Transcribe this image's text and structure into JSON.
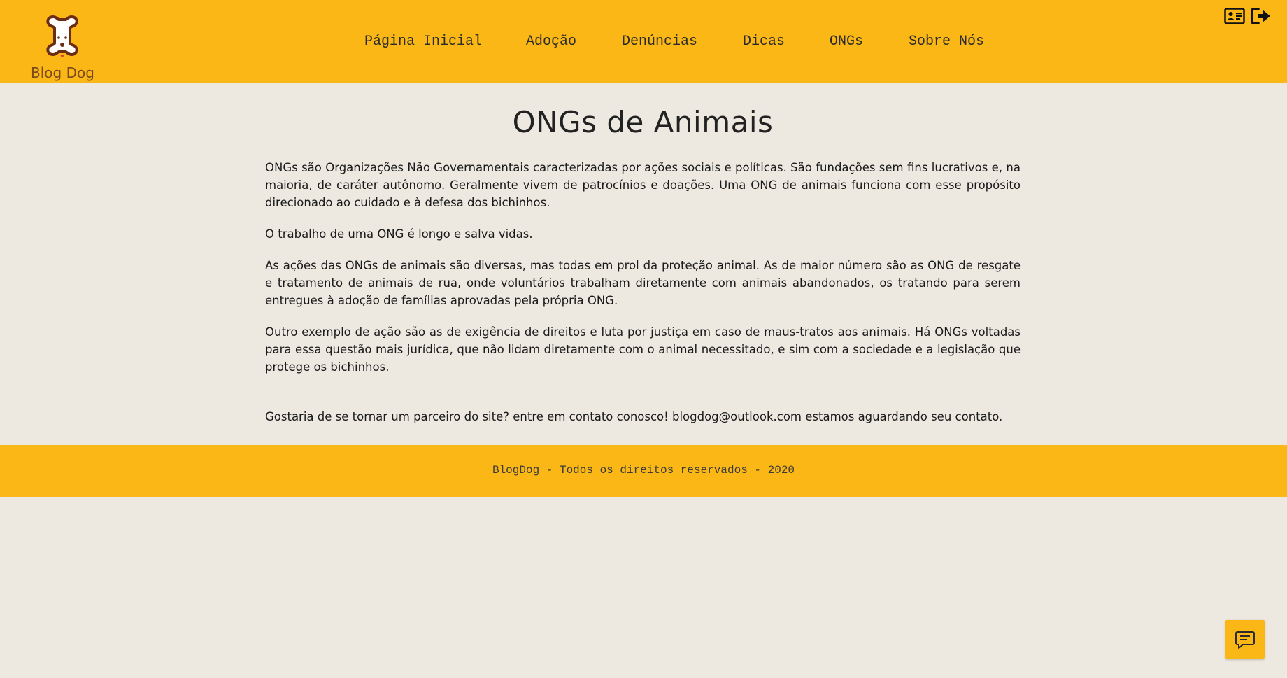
{
  "brand": {
    "name": "Blog Dog",
    "logo_icon": "dog-bone-icon"
  },
  "nav": {
    "items": [
      {
        "label": "Página Inicial"
      },
      {
        "label": "Adoção"
      },
      {
        "label": "Denúncias"
      },
      {
        "label": "Dicas"
      },
      {
        "label": "ONGs"
      },
      {
        "label": "Sobre Nós"
      }
    ]
  },
  "header_icons": {
    "profile_icon": "id-card-icon",
    "logout_icon": "sign-out-icon"
  },
  "main": {
    "title": "ONGs de Animais",
    "paragraphs": [
      "ONGs são Organizações Não Governamentais caracterizadas por ações sociais e políticas. São fundações sem fins lucrativos e, na maioria, de caráter autônomo. Geralmente vivem de patrocínios e doações. Uma ONG de animais funciona com esse propósito direcionado ao cuidado e à defesa dos bichinhos.",
      "O trabalho de uma ONG é longo e salva vidas.",
      "As ações das ONGs de animais são diversas, mas todas em prol da proteção animal. As de maior número são as ONG de resgate e tratamento de animais de rua, onde voluntários trabalham diretamente com animais abandonados, os tratando para serem entregues à adoção de famílias aprovadas pela própria ONG.",
      "Outro exemplo de ação são as de exigência de direitos e luta por justiça em caso de maus-tratos aos animais. Há ONGs voltadas para essa questão mais jurídica, que não lidam diretamente com o animal necessitado, e sim com a sociedade e a legislação que protege os bichinhos."
    ],
    "contact": "Gostaria de se tornar um parceiro do site? entre em contato conosco! blogdog@outlook.com estamos aguardando seu contato."
  },
  "footer": {
    "text": "BlogDog - Todos os direitos reservados - 2020"
  },
  "chat": {
    "icon": "chat-icon"
  },
  "colors": {
    "brand_yellow": "#FBB715",
    "background": "#EDE9E1",
    "logo_brown": "#6b2d14"
  }
}
